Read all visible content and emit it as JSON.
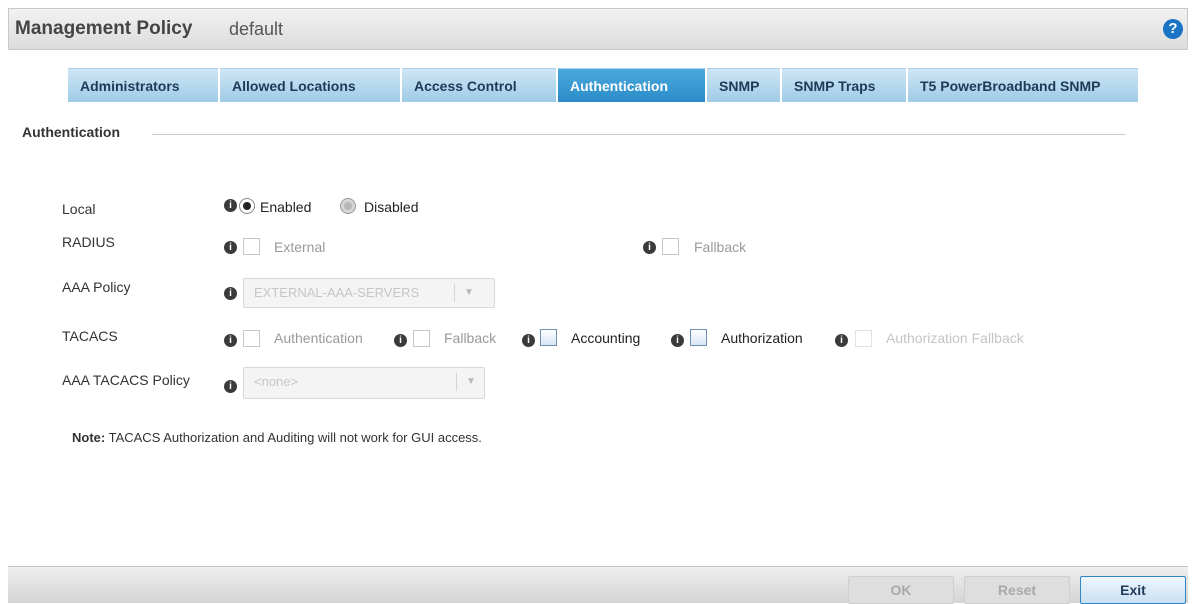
{
  "header": {
    "title": "Management Policy",
    "policy_name": "default",
    "help_icon": "question-circle-icon"
  },
  "tabs": [
    {
      "label": "Administrators",
      "active": false
    },
    {
      "label": "Allowed Locations",
      "active": false
    },
    {
      "label": "Access Control",
      "active": false
    },
    {
      "label": "Authentication",
      "active": true
    },
    {
      "label": "SNMP",
      "active": false
    },
    {
      "label": "SNMP Traps",
      "active": false
    },
    {
      "label": "T5 PowerBroadband SNMP",
      "active": false
    }
  ],
  "section": {
    "title": "Authentication"
  },
  "form": {
    "local": {
      "label": "Local",
      "enabled_label": "Enabled",
      "disabled_label": "Disabled",
      "selected": "Enabled"
    },
    "radius": {
      "label": "RADIUS",
      "external_label": "External",
      "fallback_label": "Fallback"
    },
    "aaa_policy": {
      "label": "AAA Policy",
      "value": "EXTERNAL-AAA-SERVERS"
    },
    "tacacs": {
      "label": "TACACS",
      "authentication_label": "Authentication",
      "fallback_label": "Fallback",
      "accounting_label": "Accounting",
      "authorization_label": "Authorization",
      "authorization_fallback_label": "Authorization Fallback"
    },
    "aaa_tacacs_policy": {
      "label": "AAA TACACS Policy",
      "value": "<none>"
    }
  },
  "note": {
    "prefix": "Note:",
    "text": " TACACS Authorization and Auditing will not work for GUI access."
  },
  "footer": {
    "ok_label": "OK",
    "reset_label": "Reset",
    "exit_label": "Exit"
  },
  "colors": {
    "active_tab": "#2b8cc9",
    "inactive_tab": "#b7daf0",
    "help_icon": "#1a74c4"
  }
}
